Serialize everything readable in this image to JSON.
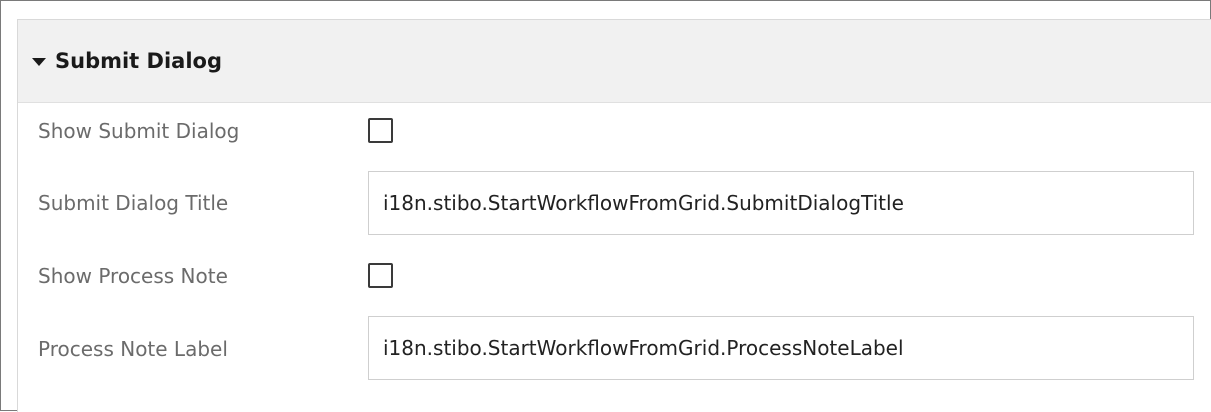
{
  "section": {
    "title": "Submit Dialog",
    "expanded_icon": "caret-down-icon"
  },
  "fields": {
    "show_submit_dialog": {
      "label": "Show Submit Dialog",
      "checked": false
    },
    "submit_dialog_title": {
      "label": "Submit Dialog Title",
      "value": "i18n.stibo.StartWorkflowFromGrid.SubmitDialogTitle"
    },
    "show_process_note": {
      "label": "Show Process Note",
      "checked": false
    },
    "process_note_label": {
      "label": "Process Note Label",
      "value": "i18n.stibo.StartWorkflowFromGrid.ProcessNoteLabel"
    }
  },
  "colors": {
    "header_bg": "#f1f1f1",
    "label_text": "#6b6b6b",
    "value_text": "#222222"
  }
}
